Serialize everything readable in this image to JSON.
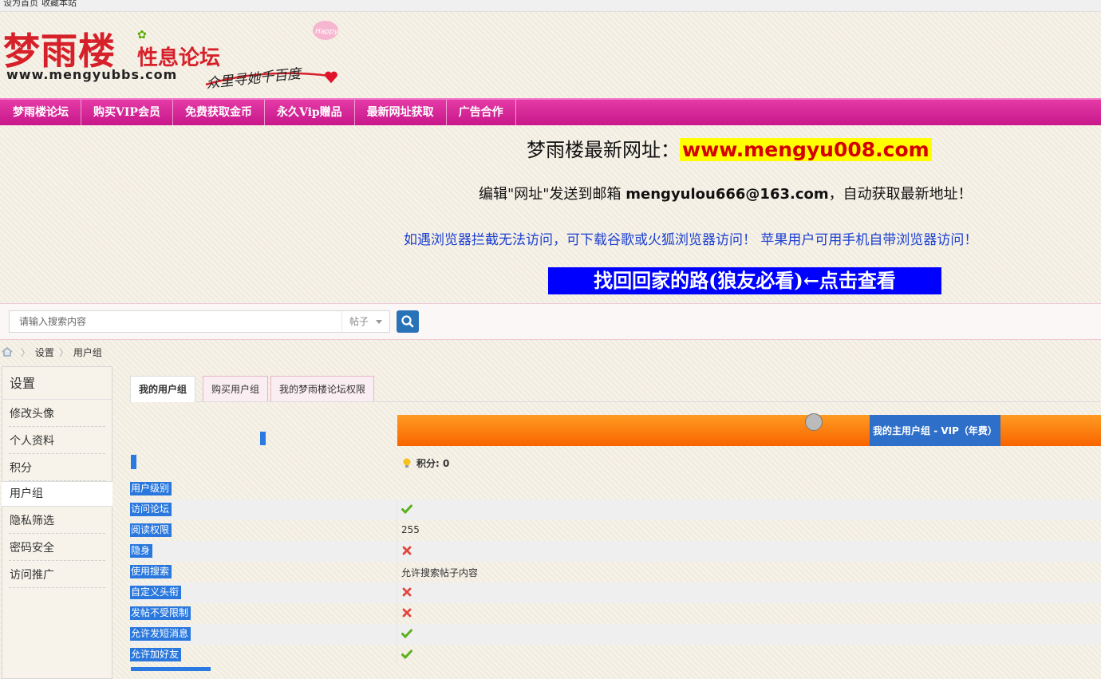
{
  "topbar": {
    "set_home": "设为首页",
    "bookmark": "收藏本站"
  },
  "logo": {
    "main": "梦雨楼",
    "sub": "性息论坛",
    "url": "www.mengyubbs.com",
    "slogan": "众里寻她千百度",
    "badge": "Happy"
  },
  "nav": [
    {
      "label": "梦雨楼论坛"
    },
    {
      "label": "购买VIP会员"
    },
    {
      "label": "免费获取金币"
    },
    {
      "label": "永久Vip赠品"
    },
    {
      "label": "最新网址获取"
    },
    {
      "label": "广告合作"
    }
  ],
  "announcements": {
    "line1_prefix": "梦雨楼最新网址：",
    "line1_url": "www.mengyu008.com",
    "line2_prefix": "编辑\"网址\"发送到邮箱 ",
    "line2_email": "mengyulou666@163.com",
    "line2_suffix": "，自动获取最新地址！",
    "line3": "如遇浏览器拦截无法访问，可下载谷歌或火狐浏览器访问！ 苹果用户可用手机自带浏览器访问！",
    "line4": "找回回家的路(狼友必看)←点击查看"
  },
  "search": {
    "placeholder": "请输入搜索内容",
    "type": "帖子"
  },
  "breadcrumb": [
    "设置",
    "用户组"
  ],
  "sidebar": {
    "title": "设置",
    "items": [
      {
        "label": "修改头像"
      },
      {
        "label": "个人资料"
      },
      {
        "label": "积分"
      },
      {
        "label": "用户组"
      },
      {
        "label": "隐私筛选"
      },
      {
        "label": "密码安全"
      },
      {
        "label": "访问推广"
      }
    ],
    "active_index": 3
  },
  "tabs": [
    {
      "label": "我的用户组"
    },
    {
      "label": "购买用户组"
    },
    {
      "label": "我的梦雨楼论坛权限"
    }
  ],
  "usergroup": {
    "main_group": "我的主用户组 - VIP（年费）",
    "points": "积分: 0",
    "rows": [
      {
        "label": "用户级别",
        "value": ""
      },
      {
        "label": "访问论坛",
        "value": "check"
      },
      {
        "label": "阅读权限",
        "value": "255"
      },
      {
        "label": "隐身",
        "value": "cross"
      },
      {
        "label": "使用搜索",
        "value": "允许搜索帖子内容"
      },
      {
        "label": "自定义头衔",
        "value": "cross"
      },
      {
        "label": "发帖不受限制",
        "value": "cross"
      },
      {
        "label": "允许发短消息",
        "value": "check"
      },
      {
        "label": "允许加好友",
        "value": "check"
      }
    ]
  },
  "colors": {
    "nav_pink": "#d6238f",
    "logo_red": "#d6202a",
    "progress_orange": "#f87a0e",
    "label_blue": "#2a78de",
    "check_green": "#5cb01e",
    "cross_red": "#e2453c"
  }
}
